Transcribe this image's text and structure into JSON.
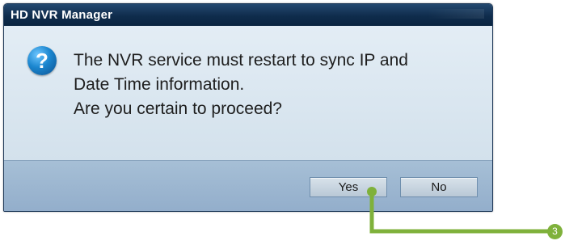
{
  "window": {
    "title": "HD NVR Manager"
  },
  "dialog": {
    "icon": "question-icon",
    "icon_glyph": "?",
    "message_lines": [
      "The NVR service must restart to sync IP and",
      "Date Time information.",
      "Are you certain to proceed?"
    ]
  },
  "buttons": {
    "yes_label": "Yes",
    "no_label": "No"
  },
  "annotation": {
    "step_number": "3",
    "color": "#7fb13b"
  }
}
